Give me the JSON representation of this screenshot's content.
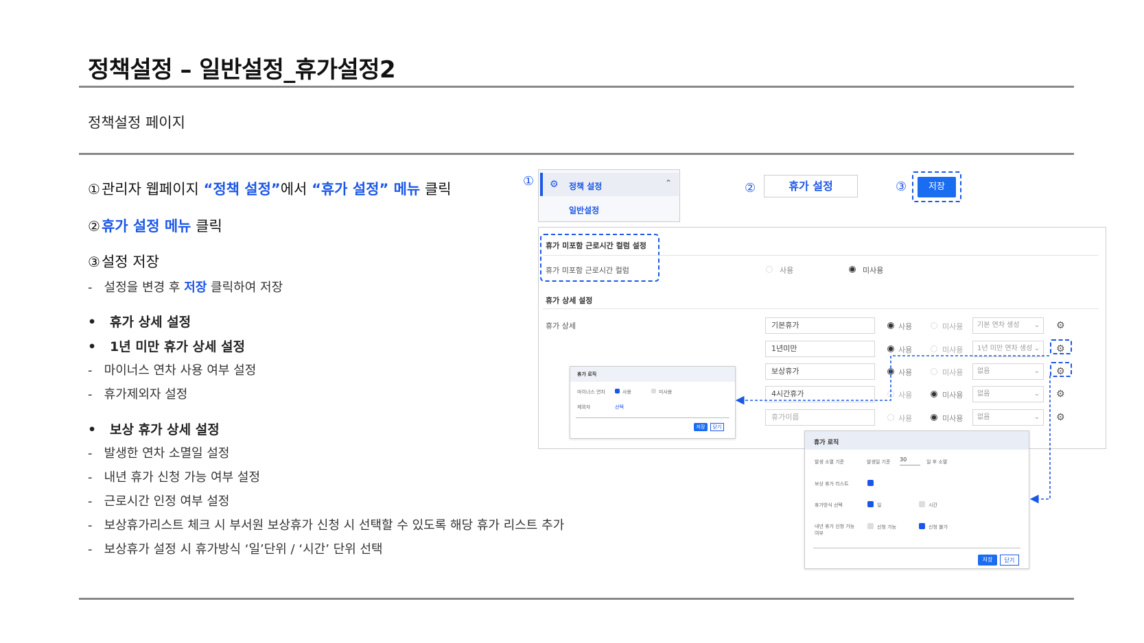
{
  "page": {
    "title": "정책설정 – 일반설정_휴가설정2",
    "subtitle": "정책설정 페이지"
  },
  "steps": {
    "s1_num": "①",
    "s1_a": "관리자 웹페이지 ",
    "s1_b": "“정책 설정”",
    "s1_c": "에서 ",
    "s1_d": "“휴가 설정” 메뉴",
    "s1_e": " 클릭",
    "s2_num": "②",
    "s2_a": "휴가 설정 메뉴",
    "s2_b": " 클릭",
    "s3_num": "③",
    "s3_a": "설정 저장",
    "s3_dash": "-",
    "s3_sub_a": "설정을 변경 후 ",
    "s3_sub_b": "저장",
    "s3_sub_c": " 클릭하여 저장"
  },
  "details": {
    "bullet_char": "•",
    "dash_char": "-",
    "b1": "휴가 상세 설정",
    "b2": "1년 미만 휴가 상세 설정",
    "b2_items": [
      "마이너스 연차 사용 여부 설정",
      "휴가제외자 설정"
    ],
    "b3": "보상 휴가 상세 설정",
    "b3_items": [
      "발생한 연차 소멸일 설정",
      "내년 휴가 신청 가능 여부 설정",
      "근로시간 인정 여부 설정",
      "보상휴가리스트 체크 시 부서원 보상휴가 신청 시 선택할 수 있도록 해당 휴가 리스트 추가",
      "보상휴가 설정 시 휴가방식 ‘일’단위 / ‘시간’ 단위 선택"
    ]
  },
  "callouts": {
    "c1": "①",
    "c2": "②",
    "c3": "③"
  },
  "menu": {
    "item": "정책 설정",
    "sub": "일반설정"
  },
  "tab_button": "휴가 설정",
  "save_button": "저장",
  "settings": {
    "section1_title": "휴가 미포함 근로시간 컬럼 설정",
    "section1_label": "휴가 미포함 근로시간 컬럼",
    "opt_use": "사용",
    "opt_nouse": "미사용",
    "section2_title": "휴가 상세 설정",
    "section2_label": "휴가 상세",
    "rows": [
      {
        "name": "기본휴가",
        "select": "기본 연차 생성"
      },
      {
        "name": "1년미만",
        "select": "1년 미만 연차 생성"
      },
      {
        "name": "보상휴가",
        "select": "없음"
      },
      {
        "name": "4시간휴가",
        "select": "없음"
      },
      {
        "name": "휴가이름",
        "select": "없음"
      }
    ]
  },
  "popup_small": {
    "title": "휴가 로직",
    "row1_label": "마이너스 연차",
    "row1_use": "사용",
    "row1_nouse": "미사용",
    "row2_label": "제외자",
    "row2_value": "선택",
    "save": "저장",
    "close": "닫기"
  },
  "popup_large": {
    "title": "휴가 로직",
    "row1_label": "발생 소멸 기준",
    "row1_prefix": "발생일 기준",
    "row1_value": "30",
    "row1_suffix": "일 후 소멸",
    "row2_label": "보상 휴가 리스트",
    "row3_label": "휴가방식 선택",
    "row3_opt1": "일",
    "row3_opt2": "시간",
    "row4_label": "내년 휴가 신청 가능",
    "row4_label2": "여부",
    "row4_opt1": "신청 가능",
    "row4_opt2": "신청 불가",
    "save": "저장",
    "close": "닫기"
  }
}
